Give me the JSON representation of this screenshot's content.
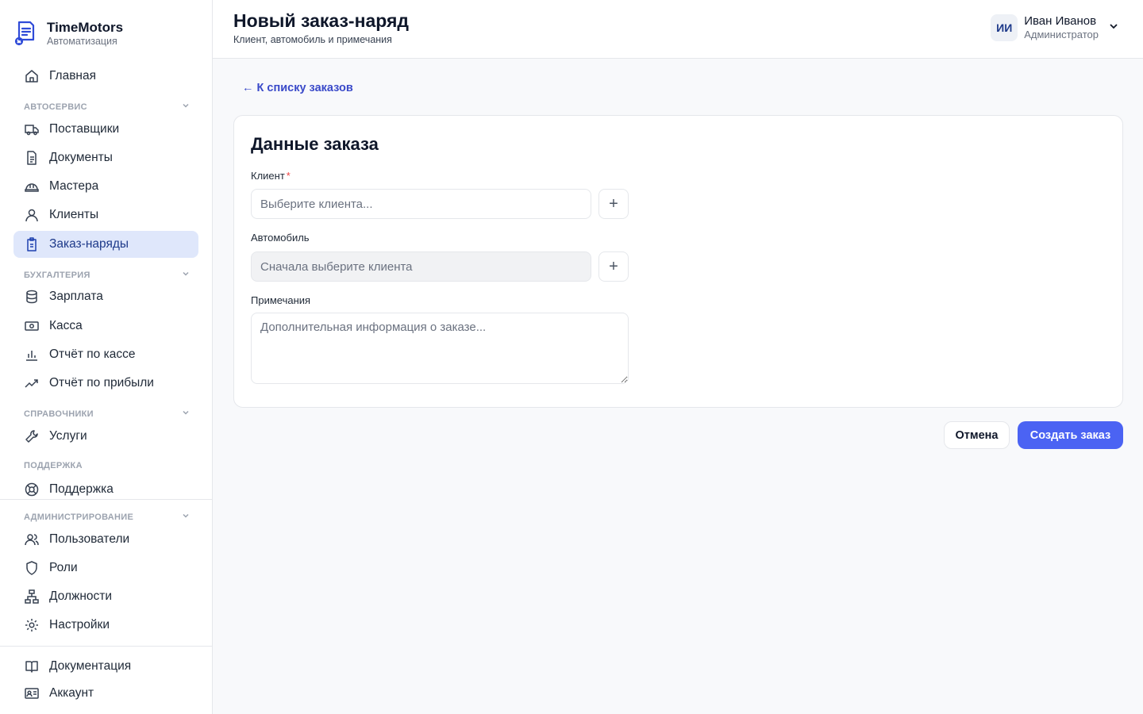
{
  "brand": {
    "name": "TimeMotors",
    "subtitle": "Автоматизация"
  },
  "sidebar": {
    "home": "Главная",
    "sections": {
      "autoservice": "АВТОСЕРВИС",
      "accounting": "БУХГАЛТЕРИЯ",
      "references": "СПРАВОЧНИКИ",
      "support": "ПОДДЕРЖКА",
      "admin": "АДМИНИСТРИРОВАНИЕ"
    },
    "items": {
      "suppliers": "Поставщики",
      "documents": "Документы",
      "masters": "Мастера",
      "clients": "Клиенты",
      "orders": "Заказ-наряды",
      "salary": "Зарплата",
      "cash": "Касса",
      "cash_report": "Отчёт по кассе",
      "profit_report": "Отчёт по прибыли",
      "services": "Услуги",
      "support": "Поддержка",
      "users": "Пользователи",
      "roles": "Роли",
      "positions": "Должности",
      "settings": "Настройки",
      "docs": "Документация",
      "account": "Аккаунт"
    },
    "active_item": "orders"
  },
  "header": {
    "title": "Новый заказ-наряд",
    "subtitle": "Клиент, автомобиль и примечания",
    "user": {
      "initials": "ИИ",
      "name": "Иван Иванов",
      "role": "Администратор"
    }
  },
  "main": {
    "back_link": "← К списку заказов",
    "card_title": "Данные заказа",
    "client": {
      "label": "Клиент",
      "required_mark": "*",
      "placeholder": "Выберите клиента..."
    },
    "car": {
      "label": "Автомобиль",
      "placeholder": "Сначала выберите клиента"
    },
    "notes": {
      "label": "Примечания",
      "placeholder": "Дополнительная информация о заказе..."
    },
    "plus": "+",
    "cancel": "Отмена",
    "create": "Создать заказ"
  },
  "colors": {
    "accent": "#4b63f3",
    "active_bg": "#dfe7fb",
    "link": "#3949c9"
  }
}
